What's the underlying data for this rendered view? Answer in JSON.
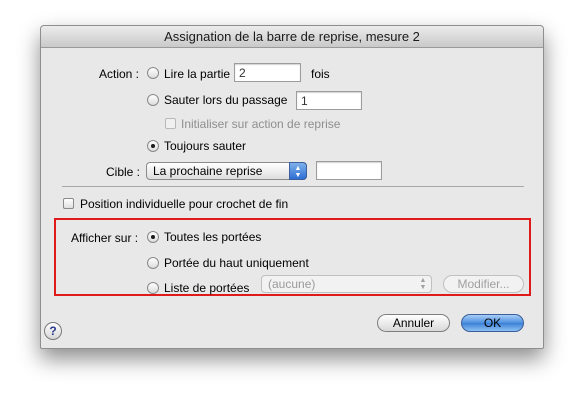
{
  "dialog": {
    "title": "Assignation de la barre de reprise, mesure 2"
  },
  "action": {
    "label": "Action :",
    "play_part": {
      "label": "Lire la partie",
      "value": "2",
      "suffix": "fois",
      "selected": false
    },
    "skip_on_pass": {
      "label": "Sauter lors du passage",
      "value": "1",
      "selected": false
    },
    "init_on_repeat": {
      "label": "Initialiser sur action de reprise",
      "checked": false,
      "enabled": false
    },
    "always_skip": {
      "label": "Toujours sauter",
      "selected": true
    }
  },
  "target": {
    "label": "Cible :",
    "selected": "La prochaine reprise",
    "value": ""
  },
  "individual_position": {
    "label": "Position individuelle pour crochet de fin",
    "checked": false
  },
  "display_on": {
    "label": "Afficher sur :",
    "options": [
      {
        "label": "Toutes les portées",
        "selected": true
      },
      {
        "label": "Portée du haut uniquement",
        "selected": false
      },
      {
        "label": "Liste de portées",
        "selected": false
      }
    ],
    "staff_list": "(aucune)",
    "modify_label": "Modifier..."
  },
  "buttons": {
    "cancel": "Annuler",
    "ok": "OK",
    "help": "?"
  },
  "colors": {
    "highlight_box": "#e01a1a",
    "default_button": "#3b7fd6"
  }
}
